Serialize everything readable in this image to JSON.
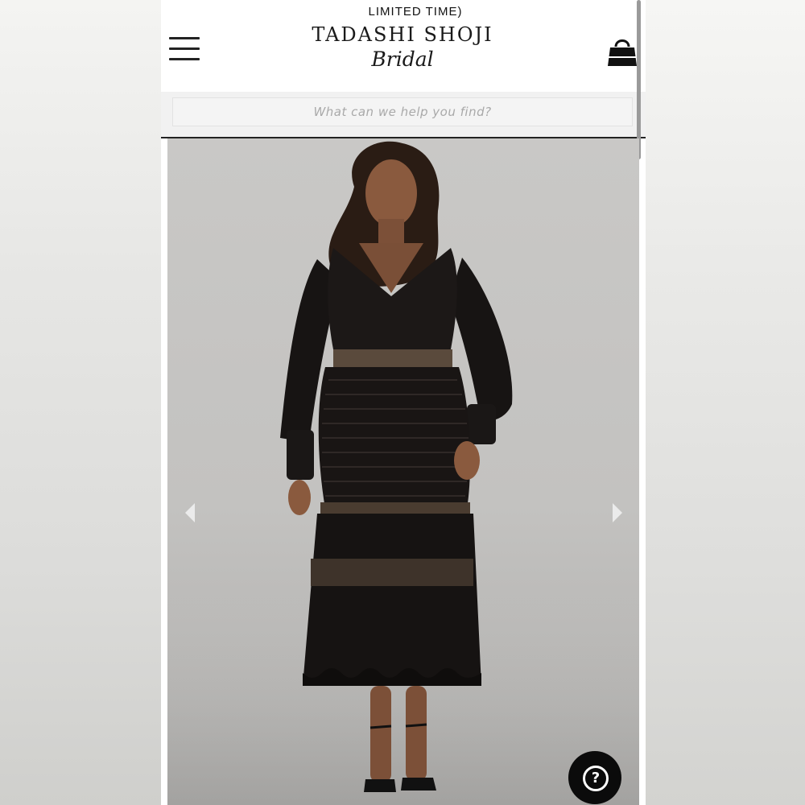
{
  "header": {
    "promo_text": "LIMITED TIME)",
    "logo_main": "TADASHI SHOJI",
    "logo_sub": "Bridal",
    "menu_icon": "hamburger-menu-icon",
    "bag_icon": "shopping-bag-icon"
  },
  "search": {
    "placeholder": "What can we help you find?"
  },
  "product_gallery": {
    "prev_icon": "chevron-left-icon",
    "next_icon": "chevron-right-icon",
    "image_alt": "Model wearing black long-sleeve lace midi dress"
  },
  "help": {
    "icon": "question-icon",
    "glyph": "?"
  },
  "colors": {
    "accent": "#111111",
    "background": "#ffffff",
    "photo_backdrop": "#c6c5c3"
  }
}
